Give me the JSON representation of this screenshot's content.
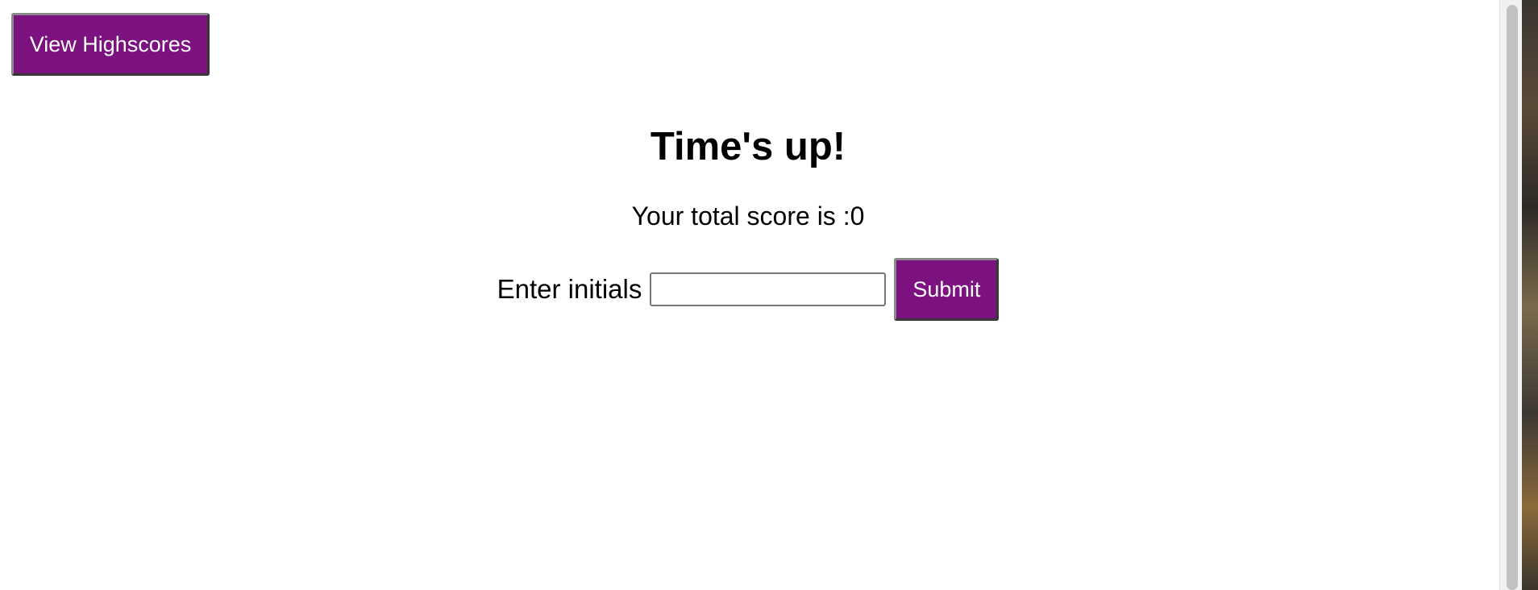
{
  "header": {
    "highscores_label": "View Highscores"
  },
  "main": {
    "title": "Time's up!",
    "score_text": "Your total score is :0",
    "initials_label": "Enter initials",
    "initials_value": "",
    "initials_placeholder": "",
    "submit_label": "Submit"
  },
  "colors": {
    "button_background": "#7b1280",
    "button_text": "#ffffff"
  }
}
